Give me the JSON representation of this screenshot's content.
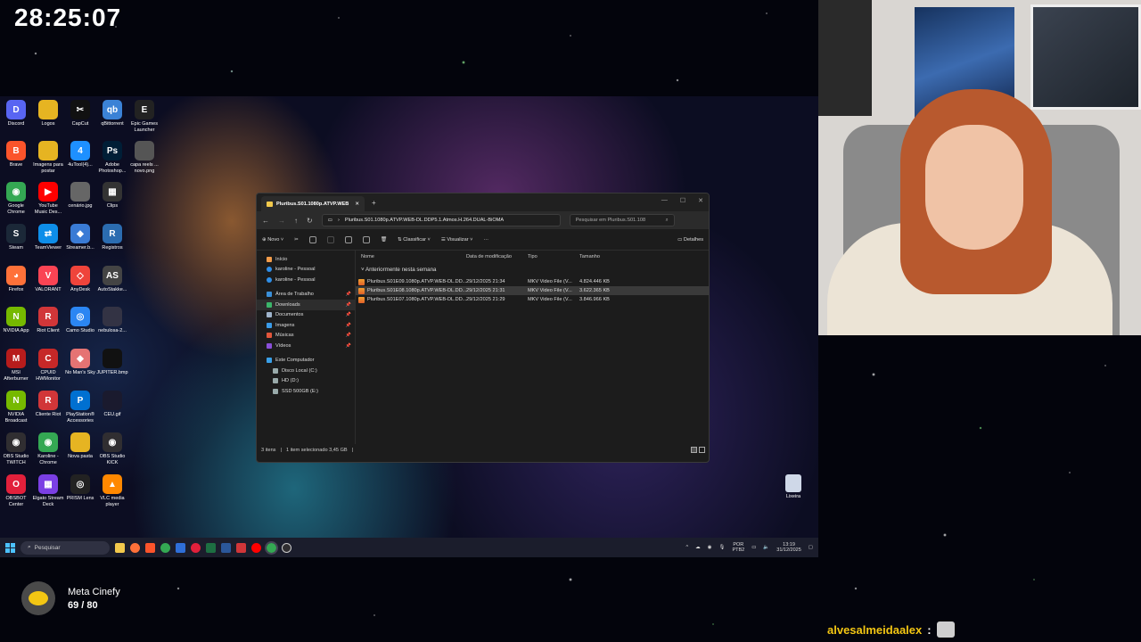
{
  "stream": {
    "timer": "28:25:07",
    "goal_title": "Meta Cinefy",
    "goal_progress": "69 / 80",
    "follower_name": "alvesalmeidaalex",
    "follower_sep": ":"
  },
  "desktop_icons": [
    {
      "label": "Discord",
      "color": "#5865f2",
      "glyph": "D"
    },
    {
      "label": "Logos",
      "color": "#e6b422",
      "glyph": ""
    },
    {
      "label": "CapCut",
      "color": "#111111",
      "glyph": "✂"
    },
    {
      "label": "qBittorrent",
      "color": "#3b82d6",
      "glyph": "qb"
    },
    {
      "label": "Epic Games Launcher",
      "color": "#222222",
      "glyph": "E"
    },
    {
      "label": "Brave",
      "color": "#fb542b",
      "glyph": "B"
    },
    {
      "label": "Imagens para postar",
      "color": "#e6b422",
      "glyph": ""
    },
    {
      "label": "4uTool(4)...",
      "color": "#1e90ff",
      "glyph": "4"
    },
    {
      "label": "Adobe Photoshop...",
      "color": "#001e36",
      "glyph": "Ps"
    },
    {
      "label": "capa reels ... novo.png",
      "color": "#555555",
      "glyph": ""
    },
    {
      "label": "Google Chrome",
      "color": "#34a853",
      "glyph": "◉"
    },
    {
      "label": "YouTube Music Des...",
      "color": "#ff0000",
      "glyph": "▶"
    },
    {
      "label": "cenário.jpg",
      "color": "#666666",
      "glyph": ""
    },
    {
      "label": "Clips",
      "color": "#333333",
      "glyph": "▦"
    },
    {
      "label": "Steam",
      "color": "#1b2838",
      "glyph": "S"
    },
    {
      "label": "TeamViewer",
      "color": "#0e8ee9",
      "glyph": "⇄"
    },
    {
      "label": "Streamer.b...",
      "color": "#3a7bd5",
      "glyph": "◆"
    },
    {
      "label": "Registros",
      "color": "#2b6cb0",
      "glyph": "R"
    },
    {
      "label": "Firefox",
      "color": "#ff7139",
      "glyph": "◕"
    },
    {
      "label": "VALORANT",
      "color": "#fa4454",
      "glyph": "V"
    },
    {
      "label": "AnyDesk",
      "color": "#ef443b",
      "glyph": "◇"
    },
    {
      "label": "AutoStakke...",
      "color": "#444444",
      "glyph": "AS"
    },
    {
      "label": "NVIDIA App",
      "color": "#76b900",
      "glyph": "N"
    },
    {
      "label": "Riot Client",
      "color": "#d13639",
      "glyph": "R"
    },
    {
      "label": "Camo Studio",
      "color": "#2b86f3",
      "glyph": "◎"
    },
    {
      "label": "nebulosa-2...",
      "color": "#333344",
      "glyph": ""
    },
    {
      "label": "MSI Afterburner",
      "color": "#b71c1c",
      "glyph": "M"
    },
    {
      "label": "CPUID HWMonitor",
      "color": "#c62828",
      "glyph": "C"
    },
    {
      "label": "No Man's Sky",
      "color": "#e57373",
      "glyph": "◆"
    },
    {
      "label": "JUPITER.bmp",
      "color": "#111111",
      "glyph": ""
    },
    {
      "label": "NVIDIA Broadcast",
      "color": "#76b900",
      "glyph": "N"
    },
    {
      "label": "Cliente Riot",
      "color": "#d13639",
      "glyph": "R"
    },
    {
      "label": "PlayStation® Accessories",
      "color": "#0070d1",
      "glyph": "P"
    },
    {
      "label": "CEU.gif",
      "color": "#1a1a2e",
      "glyph": ""
    },
    {
      "label": "OBS Studio TWITCH",
      "color": "#302e31",
      "glyph": "◉"
    },
    {
      "label": "Karoline - Chrome",
      "color": "#34a853",
      "glyph": "◉"
    },
    {
      "label": "Nova pasta",
      "color": "#e6b422",
      "glyph": ""
    },
    {
      "label": "OBS Studio KICK",
      "color": "#302e31",
      "glyph": "◉"
    },
    {
      "label": "OBSBOT Center",
      "color": "#e2203b",
      "glyph": "O"
    },
    {
      "label": "Elgato Stream Deck",
      "color": "#7b3fe4",
      "glyph": "▦"
    },
    {
      "label": "PRISM Lens",
      "color": "#222222",
      "glyph": "◎"
    },
    {
      "label": "VLC media player",
      "color": "#ff8800",
      "glyph": "▲"
    }
  ],
  "recycle_bin": "Lixeira",
  "explorer": {
    "tab_title": "Pluribus.S01.1080p.ATVP.WEB",
    "path": "Pluribus.S01.1080p.ATVP.WEB-DL.DDP5.1.Atmos.H.264.DUAL-BiOMA",
    "search_placeholder": "Pesquisar em Pluribus.S01.108",
    "toolbar": {
      "new": "Novo",
      "sort": "Classificar",
      "view": "Visualizar",
      "more": "···",
      "details": "Detalhes"
    },
    "nav": {
      "home": "Início",
      "cloud1": "karoline - Pessoal",
      "cloud2": "karoline - Pessoal",
      "desktop": "Área de Trabalho",
      "downloads": "Downloads",
      "documents": "Documentos",
      "pictures": "Imagens",
      "music": "Músicas",
      "videos": "Vídeos",
      "this_pc": "Este Computador",
      "drive_c": "Disco Local (C:)",
      "drive_d": "HD (D:)",
      "drive_e": "SSD 500GB (E:)"
    },
    "columns": {
      "name": "Nome",
      "modified": "Data de modificação",
      "type": "Tipo",
      "size": "Tamanho"
    },
    "group_label": "Anteriormente nesta semana",
    "files": [
      {
        "name": "Pluribus.S01E09.1080p.ATVP.WEB-DL.DD...",
        "modified": "29/12/2025 21:34",
        "type": "MKV Video File (V...",
        "size": "4.824.446 KB",
        "selected": false
      },
      {
        "name": "Pluribus.S01E08.1080p.ATVP.WEB-DL.DD...",
        "modified": "29/12/2025 21:31",
        "type": "MKV Video File (V...",
        "size": "3.622.365 KB",
        "selected": true
      },
      {
        "name": "Pluribus.S01E07.1080p.ATVP.WEB-DL.DD...",
        "modified": "29/12/2025 21:29",
        "type": "MKV Video File (V...",
        "size": "3.846.966 KB",
        "selected": false
      }
    ],
    "status": {
      "count": "3 itens",
      "selected": "1 item selecionado 3,45 GB"
    }
  },
  "taskbar": {
    "search_label": "Pesquisar",
    "lang_1": "POR",
    "lang_2": "PTB2",
    "time": "13:19",
    "date": "31/12/2025"
  }
}
